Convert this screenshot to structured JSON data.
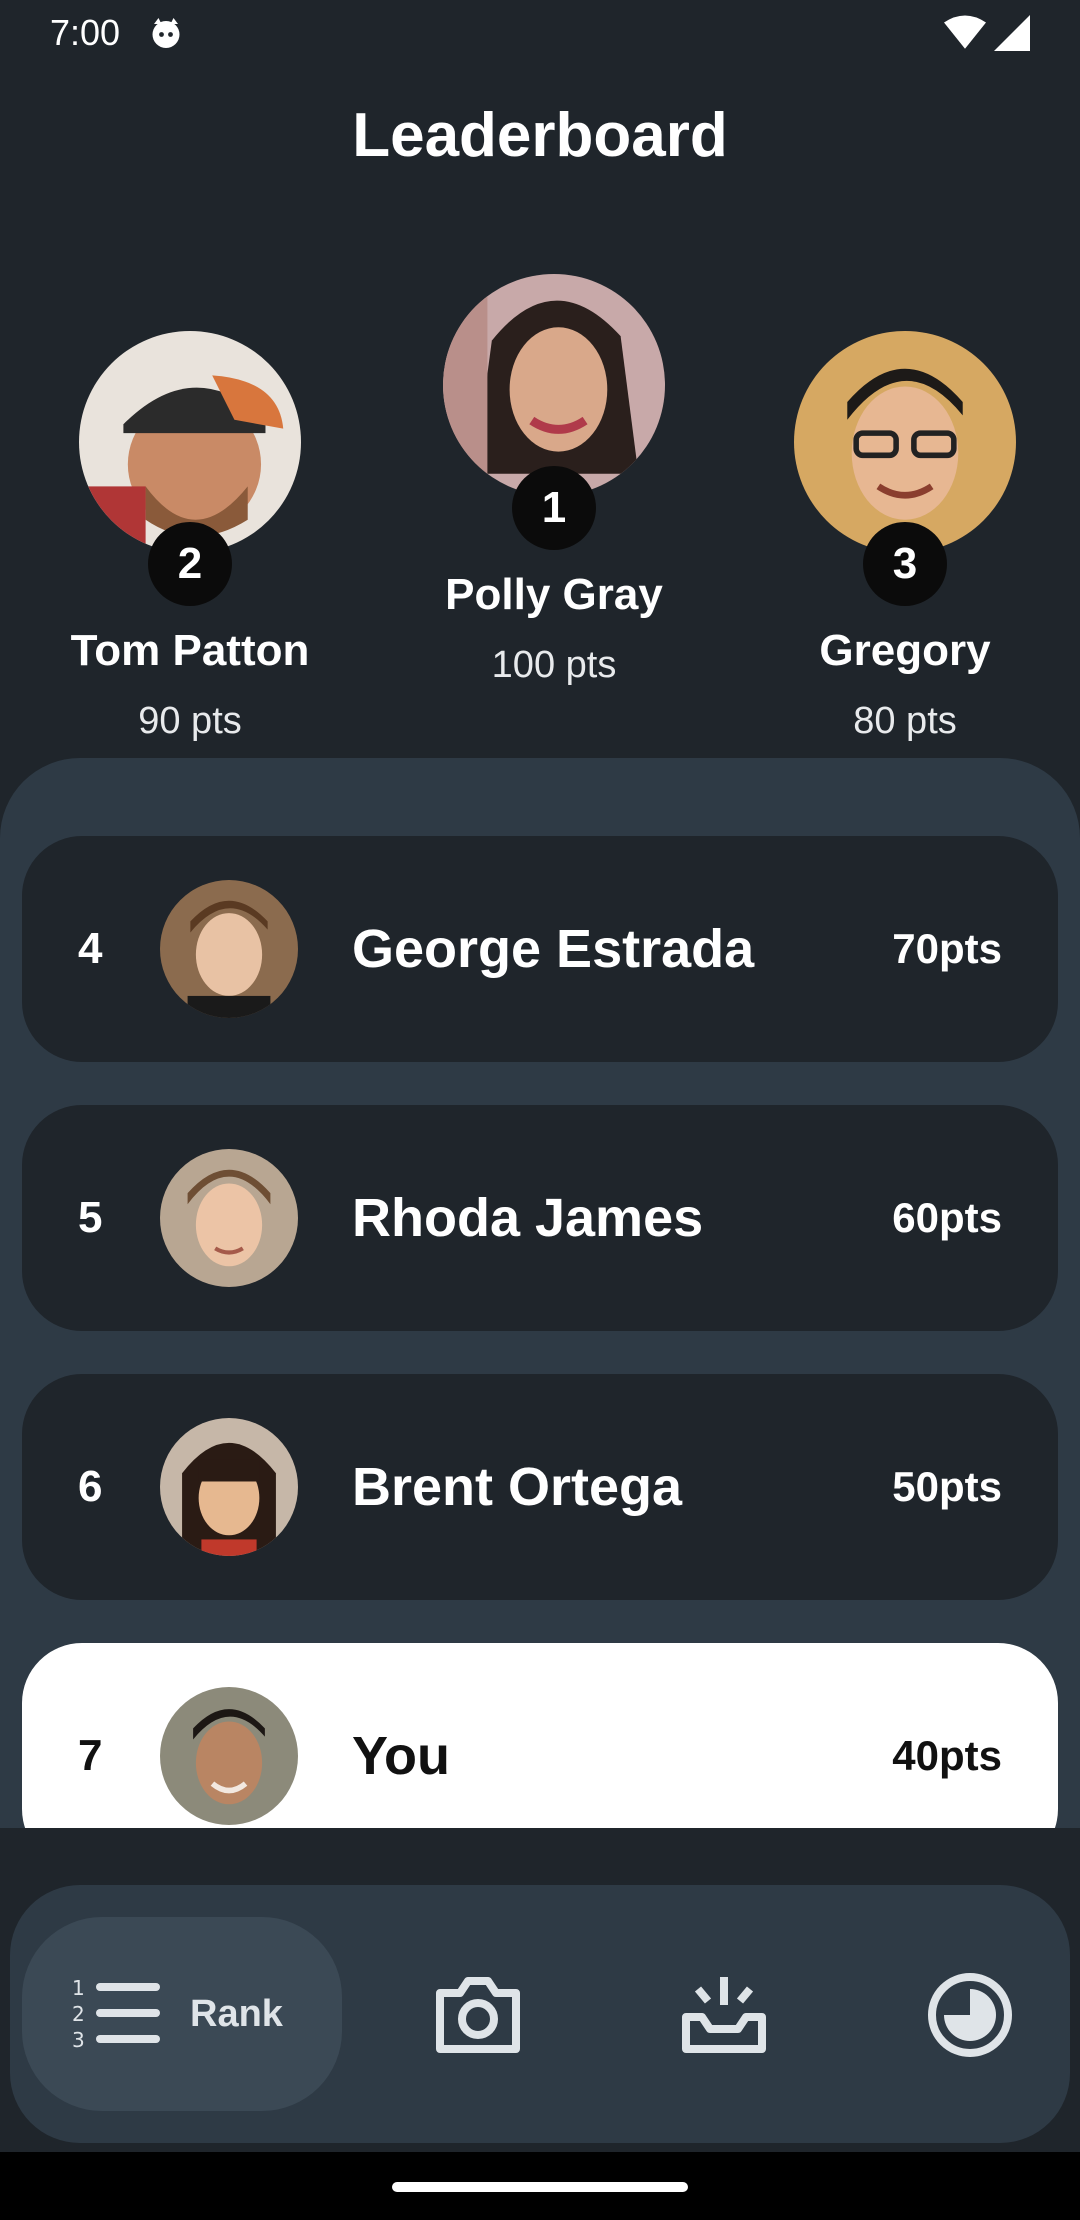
{
  "status": {
    "time": "7:00"
  },
  "title": "Leaderboard",
  "podium": [
    {
      "rank": "2",
      "name": "Tom Patton",
      "pts": "90 pts"
    },
    {
      "rank": "1",
      "name": "Polly Gray",
      "pts": "100 pts"
    },
    {
      "rank": "3",
      "name": "Gregory",
      "pts": "80 pts"
    }
  ],
  "list": [
    {
      "rank": "4",
      "name": "George Estrada",
      "pts": "70pts"
    },
    {
      "rank": "5",
      "name": "Rhoda James",
      "pts": "60pts"
    },
    {
      "rank": "6",
      "name": "Brent Ortega",
      "pts": "50pts"
    },
    {
      "rank": "7",
      "name": "You",
      "pts": "40pts"
    }
  ],
  "nav": {
    "rank_label": "Rank"
  },
  "colors": {
    "background": "#1f252b",
    "panel": "#2e3a45",
    "highlight_row": "#ffffff"
  }
}
